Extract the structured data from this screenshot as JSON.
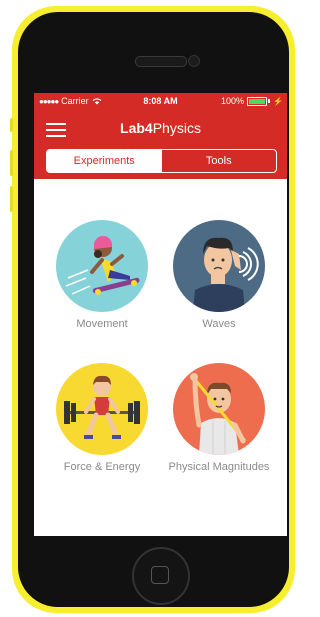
{
  "status_bar": {
    "signal_dots": "●●●●●",
    "carrier": "Carrier",
    "time": "8:08 AM",
    "battery_percent": "100%",
    "battery_level": 1.0
  },
  "header": {
    "title_bold": "Lab4",
    "title_rest": "Physics",
    "menu_icon": "hamburger-menu-icon"
  },
  "tabs": [
    {
      "label": "Experiments",
      "selected": true
    },
    {
      "label": "Tools",
      "selected": false
    }
  ],
  "topics": [
    {
      "label": "Movement",
      "circle_color": "#85d3d8"
    },
    {
      "label": "Waves",
      "circle_color": "#4d6b84"
    },
    {
      "label": "Force & Energy",
      "circle_color": "#f7d932"
    },
    {
      "label": "Physical Magnitudes",
      "circle_color": "#ee6d4e"
    }
  ],
  "colors": {
    "brand_red": "#d52b27",
    "phone_yellow": "#f7ee2f",
    "label_gray": "#8a8a8a"
  }
}
